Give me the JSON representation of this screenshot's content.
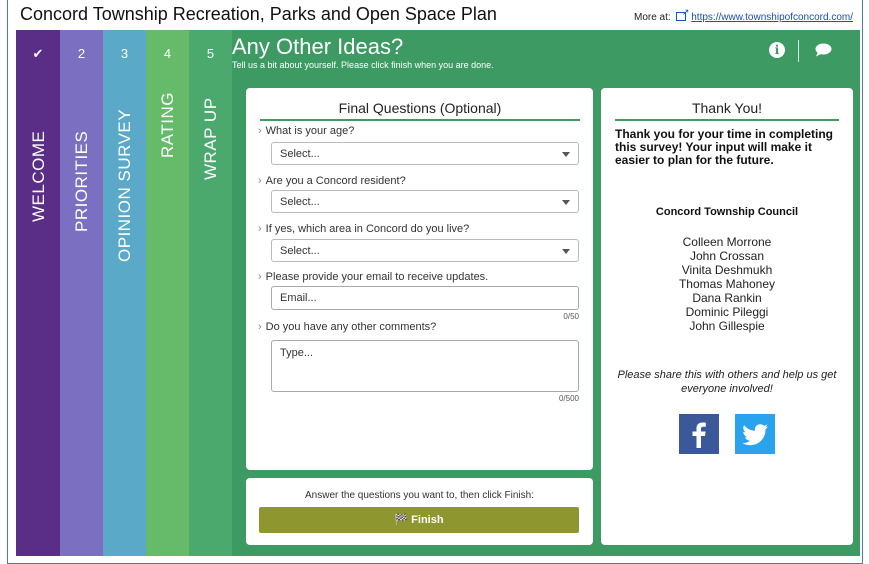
{
  "page": {
    "title": "Concord Township Recreation, Parks and Open Space Plan",
    "more_at_label": "More at:",
    "more_at_link": "https://www.townshipofconcord.com/"
  },
  "tabs": [
    {
      "number": "✔",
      "label": "WELCOME",
      "color": "#5a2d86"
    },
    {
      "number": "2",
      "label": "PRIORITIES",
      "color": "#7a6fc0"
    },
    {
      "number": "3",
      "label": "OPINION SURVEY",
      "color": "#5aa9c9"
    },
    {
      "number": "4",
      "label": "RATING",
      "color": "#66bb6a"
    },
    {
      "number": "5",
      "label": "WRAP UP",
      "color": "#4ba96d"
    }
  ],
  "header": {
    "title": "Any Other Ideas?",
    "subtitle": "Tell us a bit about yourself. Please click finish when you are done.",
    "icons": [
      "info-icon",
      "chat-bubble-icon"
    ]
  },
  "questions_card": {
    "heading": "Final Questions (Optional)",
    "q_age": "What is your age?",
    "age_value": "Select...",
    "q_resident": "Are you a Concord resident?",
    "resident_value": "Select...",
    "q_area": "If yes, which area in Concord do you live?",
    "area_value": "Select...",
    "q_email": "Please provide your email to receive updates.",
    "email_placeholder": "Email...",
    "email_count": "0/50",
    "q_comments": "Do you have any other comments?",
    "comments_placeholder": "Type...",
    "comments_count": "0/500"
  },
  "footer": {
    "text": "Answer the questions you want to, then click Finish:",
    "finish_label": "🏁 Finish"
  },
  "thanks_card": {
    "heading": "Thank You!",
    "body": "Thank you for your time in completing this survey! Your input will make it easier to plan for the future.",
    "council_heading": "Concord Township Council",
    "members": [
      "Colleen Morrone",
      "John Crossan",
      "Vinita Deshmukh",
      "Thomas Mahoney",
      "Dana Rankin",
      "Dominic Pileggi",
      "John Gillespie"
    ],
    "share_text": "Please share this with others and help us get everyone involved!",
    "social": [
      "facebook-icon",
      "twitter-icon"
    ]
  },
  "colors": {
    "main_bg": "#3d9a63",
    "finish_button": "#8e962f",
    "facebook": "#3b5998",
    "twitter": "#2aa3ef"
  }
}
